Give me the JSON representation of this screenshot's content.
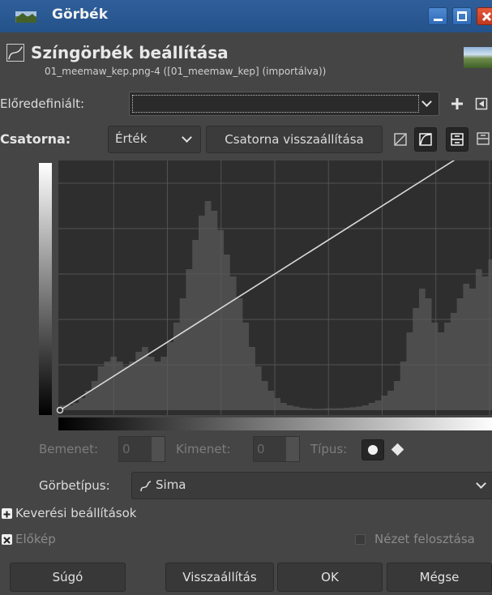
{
  "window": {
    "title": "Görbék"
  },
  "header": {
    "title": "Színgörbék beállítása",
    "subtitle": "01_meemaw_kep.png-4 ([01_meemaw_kep] (importálva))"
  },
  "presets": {
    "label": "Előredefiniált:",
    "value": ""
  },
  "channel": {
    "label": "Csatorna:",
    "value": "Érték",
    "reset_label": "Csatorna visszaállítása"
  },
  "point": {
    "input_label": "Bemenet:",
    "input_value": "0",
    "output_label": "Kimenet:",
    "output_value": "0",
    "type_label": "Típus:"
  },
  "curve_type": {
    "label": "Görbetípus:",
    "value": "Sima"
  },
  "blending": {
    "label": "Keverési beállítások"
  },
  "preview": {
    "label": "Előkép",
    "checked": true
  },
  "split_view": {
    "label": "Nézet felosztása",
    "checked": false
  },
  "buttons": {
    "help": "Súgó",
    "reset": "Visszaállítás",
    "ok": "OK",
    "cancel": "Mégse"
  },
  "colors": {
    "titlebar": "#2b5a95",
    "background": "#454545",
    "histogram": "#4d4d4d",
    "graph_bg": "#2e2e2e",
    "close_button": "#d4472a"
  },
  "histogram": {
    "bins": [
      0.02,
      0.02,
      0.03,
      0.05,
      0.08,
      0.12,
      0.18,
      0.2,
      0.22,
      0.2,
      0.18,
      0.2,
      0.24,
      0.26,
      0.22,
      0.2,
      0.22,
      0.28,
      0.36,
      0.46,
      0.58,
      0.7,
      0.8,
      0.86,
      0.82,
      0.74,
      0.64,
      0.55,
      0.46,
      0.36,
      0.26,
      0.18,
      0.12,
      0.08,
      0.05,
      0.03,
      0.02,
      0.015,
      0.01,
      0.008,
      0.006,
      0.006,
      0.008,
      0.008,
      0.008,
      0.01,
      0.012,
      0.015,
      0.02,
      0.03,
      0.04,
      0.06,
      0.08,
      0.12,
      0.2,
      0.32,
      0.42,
      0.5,
      0.46,
      0.36,
      0.32,
      0.36,
      0.4,
      0.46,
      0.52,
      0.5,
      0.58,
      0.55,
      0.62,
      0.75
    ]
  }
}
